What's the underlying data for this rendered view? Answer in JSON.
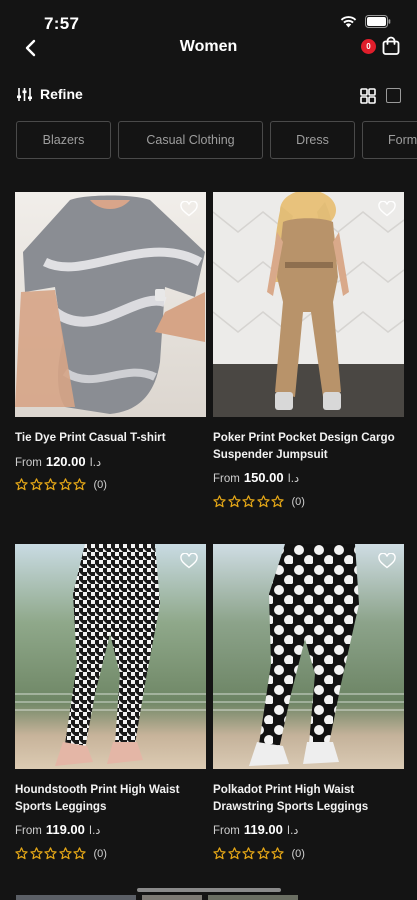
{
  "status_bar": {
    "time": "7:57"
  },
  "header": {
    "title": "Women",
    "cart_count": "0"
  },
  "toolbar": {
    "refine_label": "Refine"
  },
  "categories": [
    "Blazers",
    "Casual Clothing",
    "Dress",
    "Form"
  ],
  "products": [
    {
      "name": "Tie Dye Print Casual T-shirt",
      "price_prefix": "From",
      "price": "120.00",
      "currency": "د.ا",
      "rating_count": "(0)"
    },
    {
      "name": "Poker Print Pocket Design Cargo Suspender Jumpsuit",
      "price_prefix": "From",
      "price": "150.00",
      "currency": "د.ا",
      "rating_count": "(0)"
    },
    {
      "name": "Houndstooth Print High Waist Sports Leggings",
      "price_prefix": "From",
      "price": "119.00",
      "currency": "د.ا",
      "rating_count": "(0)"
    },
    {
      "name": "Polkadot Print High Waist Drawstring Sports Leggings",
      "price_prefix": "From",
      "price": "119.00",
      "currency": "د.ا",
      "rating_count": "(0)"
    }
  ],
  "colors": {
    "background": "#141414",
    "star": "#e6a817",
    "badge": "#e01e2b",
    "chip_border": "#4a4a4a"
  },
  "icons": [
    "back-arrow-icon",
    "cart-icon",
    "refine-sliders-icon",
    "grid-view-icon",
    "single-view-icon",
    "heart-icon",
    "star-icon"
  ]
}
